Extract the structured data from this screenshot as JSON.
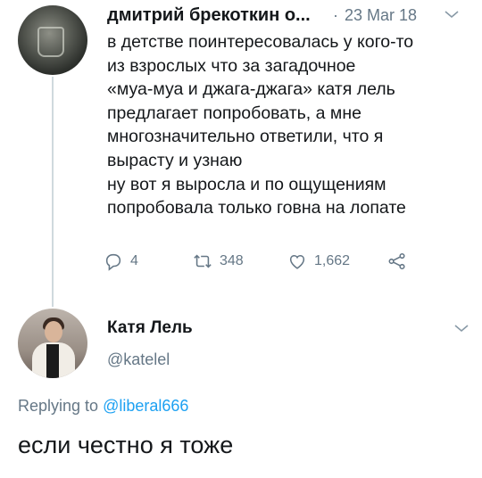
{
  "tweet": {
    "author_name": "дмитрий брекоткин о...",
    "separator": "·",
    "date": "23 Mar 18",
    "text_lines": [
      "в детстве поинтересовалась у кого-то",
      "из взрослых что за загадочное",
      "«муа-муа и джага-джага» катя лель",
      "предлагает попробовать, а мне",
      "многозначительно ответили, что я",
      "вырасту и узнаю",
      "ну вот я выросла и по ощущениям",
      "попробовала только говна на лопате"
    ],
    "reply_count": "4",
    "retweet_count": "348",
    "like_count": "1,662"
  },
  "reply": {
    "author_name": "Катя Лель",
    "handle": "@katelel",
    "replying_label": "Replying to ",
    "replying_handle": "@liberal666",
    "text": "если честно я тоже"
  },
  "colors": {
    "text": "#14171a",
    "muted": "#657786",
    "link": "#1da1f2",
    "thread_line": "#cfd9de"
  },
  "icons": [
    "reply-icon",
    "retweet-icon",
    "like-icon",
    "share-icon",
    "chevron-down-icon"
  ]
}
